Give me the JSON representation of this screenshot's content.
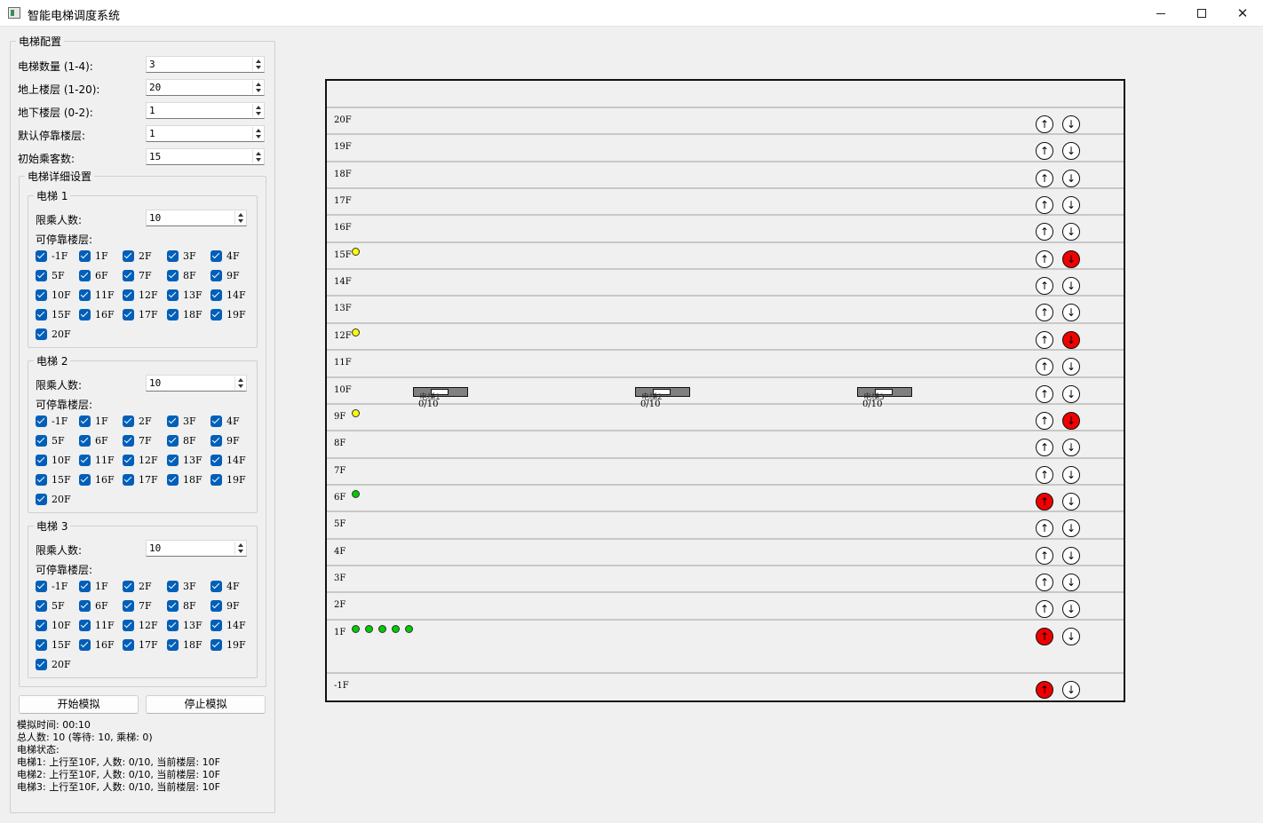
{
  "window": {
    "title": "智能电梯调度系统"
  },
  "config": {
    "group_title": "电梯配置",
    "rows": [
      {
        "label": "电梯数量 (1-4):",
        "value": "3"
      },
      {
        "label": "地上楼层 (1-20):",
        "value": "20"
      },
      {
        "label": "地下楼层 (0-2):",
        "value": "1"
      },
      {
        "label": "默认停靠楼层:",
        "value": "1"
      },
      {
        "label": "初始乘客数:",
        "value": "15"
      }
    ],
    "details_title": "电梯详细设置",
    "capacity_label": "限乘人数:",
    "stops_label": "可停靠楼层:",
    "elevators": [
      {
        "title": "电梯 1",
        "capacity": "10"
      },
      {
        "title": "电梯 2",
        "capacity": "10"
      },
      {
        "title": "电梯 3",
        "capacity": "10"
      }
    ],
    "floor_options": [
      "-1F",
      "1F",
      "2F",
      "3F",
      "4F",
      "5F",
      "6F",
      "7F",
      "8F",
      "9F",
      "10F",
      "11F",
      "12F",
      "13F",
      "14F",
      "15F",
      "16F",
      "17F",
      "18F",
      "19F",
      "20F"
    ]
  },
  "controls": {
    "start": "开始模拟",
    "stop": "停止模拟"
  },
  "status": {
    "time": "模拟时间: 00:10",
    "total": "总人数: 10 (等待: 10, 乘梯: 0)",
    "header": "电梯状态:",
    "elevators": [
      "电梯1: 上行至10F, 人数: 0/10, 当前楼层: 10F",
      "电梯2: 上行至10F, 人数: 0/10, 当前楼层: 10F",
      "电梯3: 上行至10F, 人数: 0/10, 当前楼层: 10F"
    ]
  },
  "building": {
    "floors": [
      {
        "label": "20F",
        "up": false,
        "down": false,
        "waiting": []
      },
      {
        "label": "19F",
        "up": false,
        "down": false,
        "waiting": []
      },
      {
        "label": "18F",
        "up": false,
        "down": false,
        "waiting": []
      },
      {
        "label": "17F",
        "up": false,
        "down": false,
        "waiting": []
      },
      {
        "label": "16F",
        "up": false,
        "down": false,
        "waiting": []
      },
      {
        "label": "15F",
        "up": false,
        "down": true,
        "waiting": [
          "down"
        ]
      },
      {
        "label": "14F",
        "up": false,
        "down": false,
        "waiting": []
      },
      {
        "label": "13F",
        "up": false,
        "down": false,
        "waiting": []
      },
      {
        "label": "12F",
        "up": false,
        "down": true,
        "waiting": [
          "down"
        ]
      },
      {
        "label": "11F",
        "up": false,
        "down": false,
        "waiting": []
      },
      {
        "label": "10F",
        "up": false,
        "down": false,
        "waiting": []
      },
      {
        "label": "9F",
        "up": false,
        "down": true,
        "waiting": [
          "down"
        ]
      },
      {
        "label": "8F",
        "up": false,
        "down": false,
        "waiting": []
      },
      {
        "label": "7F",
        "up": false,
        "down": false,
        "waiting": []
      },
      {
        "label": "6F",
        "up": true,
        "down": false,
        "waiting": [
          "up"
        ]
      },
      {
        "label": "5F",
        "up": false,
        "down": false,
        "waiting": []
      },
      {
        "label": "4F",
        "up": false,
        "down": false,
        "waiting": []
      },
      {
        "label": "3F",
        "up": false,
        "down": false,
        "waiting": []
      },
      {
        "label": "2F",
        "up": false,
        "down": false,
        "waiting": []
      },
      {
        "label": "1F",
        "up": true,
        "down": false,
        "waiting": [
          "up",
          "up",
          "up",
          "up",
          "up"
        ]
      },
      {
        "label": "-1F",
        "up": true,
        "down": false,
        "waiting": []
      }
    ],
    "cars": [
      {
        "name": "电梯1",
        "load": "0/10",
        "floor": "10F"
      },
      {
        "name": "电梯2",
        "load": "0/10",
        "floor": "10F"
      },
      {
        "name": "电梯3",
        "load": "0/10",
        "floor": "10F"
      }
    ],
    "up_glyph": "↑",
    "down_glyph": "↓",
    "colors": {
      "active_call": "#f00000",
      "waiting_up": "#00cc00",
      "waiting_down": "#ffff00",
      "car": "#808080"
    }
  }
}
